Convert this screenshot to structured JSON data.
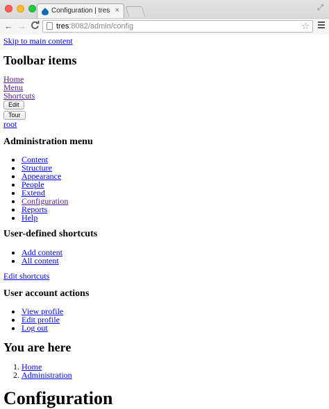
{
  "browser": {
    "tab_title": "Configuration | tres",
    "tab_close": "×",
    "url_host": "tres",
    "url_path": ":8082/admin/config",
    "star_glyph": "☆",
    "back_glyph": "←",
    "forward_glyph": "→",
    "reload_glyph": "C",
    "expand_glyph": "⤢"
  },
  "page": {
    "skip_link": "Skip to main content",
    "toolbar_heading": "Toolbar items",
    "toolbar_links": [
      "Home",
      "Menu",
      "Shortcuts"
    ],
    "edit_button": "Edit",
    "tour_button": "Tour",
    "user_link": "root",
    "admin_menu_heading": "Administration menu",
    "admin_menu": [
      "Content",
      "Structure",
      "Appearance",
      "People",
      "Extend",
      "Configuration",
      "Reports",
      "Help"
    ],
    "shortcuts_heading": "User-defined shortcuts",
    "shortcuts": [
      "Add content",
      "All content"
    ],
    "edit_shortcuts": "Edit shortcuts",
    "account_heading": "User account actions",
    "account_links": [
      "View profile",
      "Edit profile",
      "Log out"
    ],
    "breadcrumb_heading": "You are here",
    "breadcrumb": [
      "Home",
      "Administration"
    ],
    "page_title": "Configuration"
  }
}
